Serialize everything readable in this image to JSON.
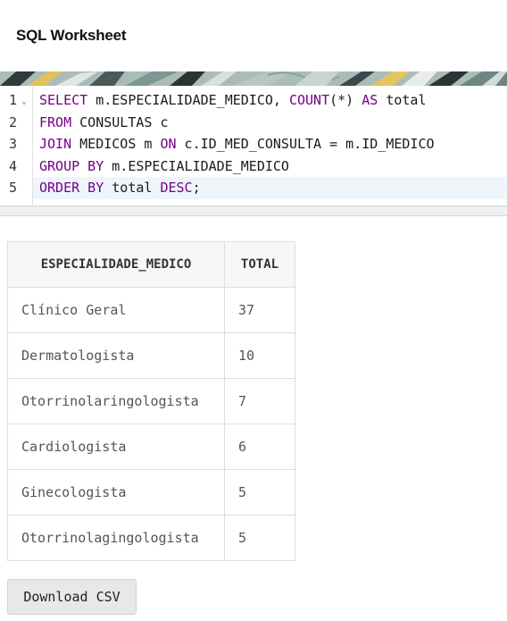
{
  "page": {
    "title": "SQL Worksheet"
  },
  "editor": {
    "line_numbers": [
      "1",
      "2",
      "3",
      "4",
      "5"
    ],
    "lines": [
      [
        [
          "kw",
          "SELECT"
        ],
        [
          "txt",
          " m.ESPECIALIDADE_MEDICO, "
        ],
        [
          "kw",
          "COUNT"
        ],
        [
          "txt",
          "(*) "
        ],
        [
          "kw",
          "AS"
        ],
        [
          "txt",
          " total"
        ]
      ],
      [
        [
          "kw",
          "FROM"
        ],
        [
          "txt",
          " CONSULTAS c"
        ]
      ],
      [
        [
          "kw",
          "JOIN"
        ],
        [
          "txt",
          " MEDICOS m "
        ],
        [
          "kw",
          "ON"
        ],
        [
          "txt",
          " c.ID_MED_CONSULTA = m.ID_MEDICO"
        ]
      ],
      [
        [
          "kw",
          "GROUP BY"
        ],
        [
          "txt",
          " m.ESPECIALIDADE_MEDICO"
        ]
      ],
      [
        [
          "kw",
          "ORDER BY"
        ],
        [
          "txt",
          " total "
        ],
        [
          "kw",
          "DESC"
        ],
        [
          "txt",
          ";"
        ]
      ]
    ],
    "active_line": 5,
    "fold_icon": "chevron-down-icon",
    "keyword_color": "#770088"
  },
  "results": {
    "columns": [
      "ESPECIALIDADE_MEDICO",
      "TOTAL"
    ],
    "rows": [
      [
        "Clínico Geral",
        "37"
      ],
      [
        "Dermatologista",
        "10"
      ],
      [
        "Otorrinolaringologista",
        "7"
      ],
      [
        "Cardiologista",
        "6"
      ],
      [
        "Ginecologista",
        "5"
      ],
      [
        "Otorrinolagingologista",
        "5"
      ]
    ]
  },
  "actions": {
    "download_label": "Download CSV"
  }
}
